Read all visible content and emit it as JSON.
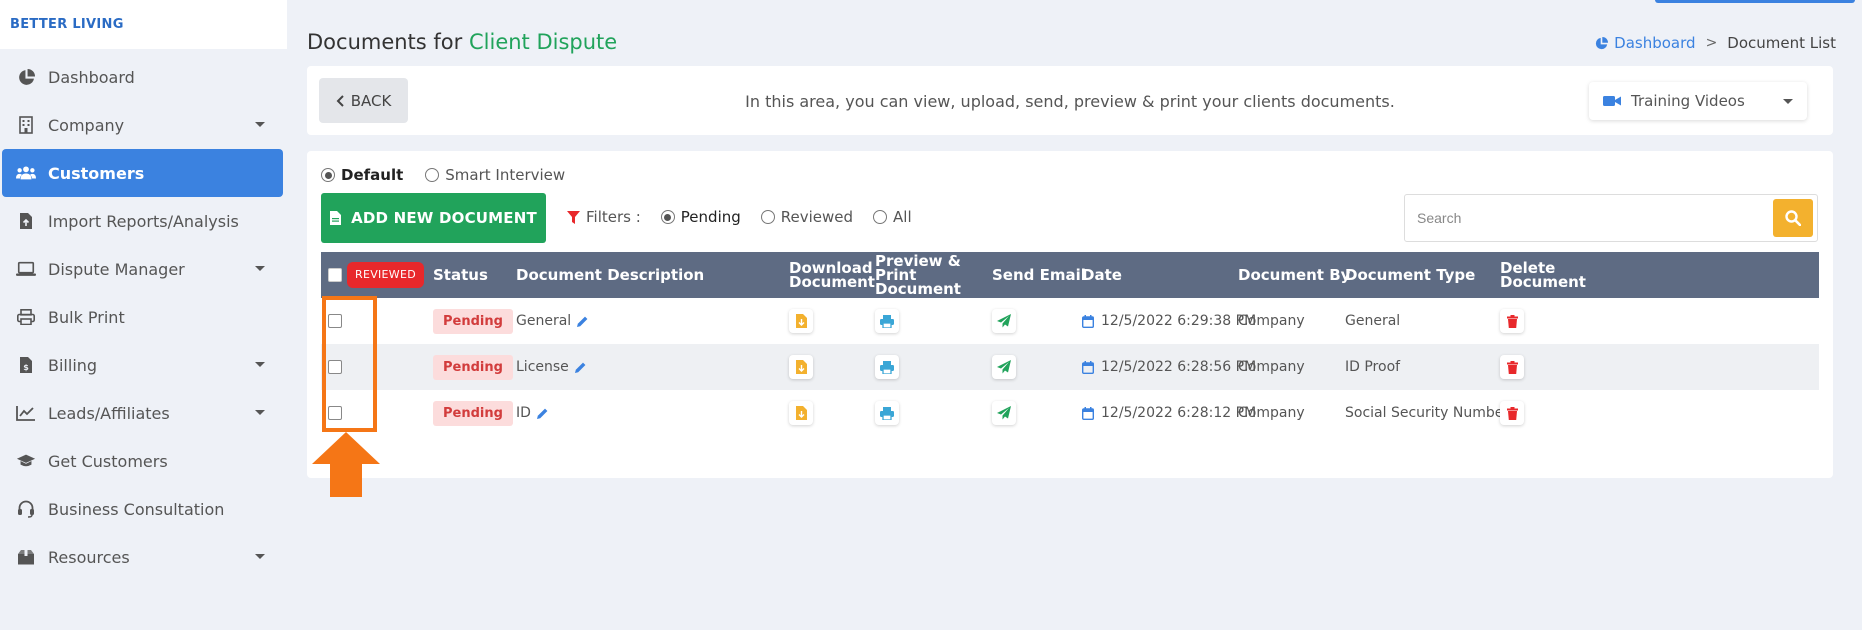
{
  "brand": "BETTER LIVING",
  "sidebar": {
    "items": [
      {
        "label": "Dashboard",
        "icon": "chart-pie-icon",
        "has_caret": false,
        "active": false
      },
      {
        "label": "Company",
        "icon": "building-icon",
        "has_caret": true,
        "active": false
      },
      {
        "label": "Customers",
        "icon": "users-icon",
        "has_caret": false,
        "active": true
      },
      {
        "label": "Import Reports/Analysis",
        "icon": "file-upload-icon",
        "has_caret": false,
        "active": false
      },
      {
        "label": "Dispute Manager",
        "icon": "laptop-icon",
        "has_caret": true,
        "active": false
      },
      {
        "label": "Bulk Print",
        "icon": "printer-icon",
        "has_caret": false,
        "active": false
      },
      {
        "label": "Billing",
        "icon": "invoice-icon",
        "has_caret": true,
        "active": false
      },
      {
        "label": "Leads/Affiliates",
        "icon": "line-chart-icon",
        "has_caret": true,
        "active": false
      },
      {
        "label": "Get Customers",
        "icon": "graduation-cap-icon",
        "has_caret": false,
        "active": false
      },
      {
        "label": "Business Consultation",
        "icon": "headset-icon",
        "has_caret": false,
        "active": false
      },
      {
        "label": "Resources",
        "icon": "box-icon",
        "has_caret": true,
        "active": false
      }
    ]
  },
  "page": {
    "title_prefix": "Documents for",
    "title_accent": "Client Dispute"
  },
  "breadcrumb": {
    "home": "Dashboard",
    "separator": ">",
    "current": "Document List"
  },
  "header": {
    "back_label": "BACK",
    "message": "In this area, you can view, upload, send, preview & print your clients documents.",
    "training_label": "Training Videos"
  },
  "mode": {
    "options": [
      "Default",
      "Smart Interview"
    ],
    "selected": "Default"
  },
  "toolbar": {
    "add_label": "ADD NEW DOCUMENT",
    "filters_label": "Filters :",
    "filter_options": [
      "Pending",
      "Reviewed",
      "All"
    ],
    "filter_selected": "Pending",
    "search_placeholder": "Search"
  },
  "table": {
    "reviewed_badge": "REVIEWED",
    "headers": {
      "status": "Status",
      "description": "Document Description",
      "download": "Download Document",
      "preview": "Preview & Print Document",
      "email": "Send Email",
      "date": "Date",
      "by": "Document By",
      "type": "Document Type",
      "delete": "Delete Document"
    },
    "rows": [
      {
        "status": "Pending",
        "description": "General",
        "date": "12/5/2022 6:29:38 PM",
        "by": "Company",
        "type": "General"
      },
      {
        "status": "Pending",
        "description": "License",
        "date": "12/5/2022 6:28:56 PM",
        "by": "Company",
        "type": "ID Proof"
      },
      {
        "status": "Pending",
        "description": "ID",
        "date": "12/5/2022 6:28:12 PM",
        "by": "Company",
        "type": "Social Security Number"
      }
    ]
  },
  "colors": {
    "primary": "#3b82e0",
    "success": "#21a35b",
    "warning": "#f3b12e",
    "danger": "#e8282b",
    "table_header": "#5e6b83",
    "annotation": "#f57616"
  }
}
